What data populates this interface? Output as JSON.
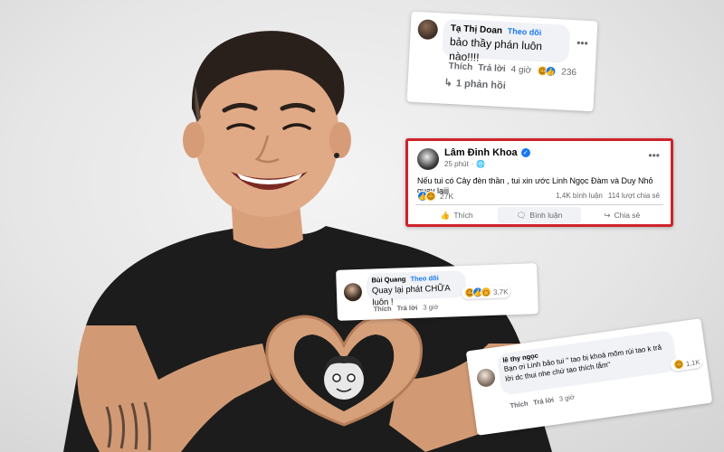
{
  "comment1": {
    "name": "Tạ Thị Doan",
    "follow": "Theo dõi",
    "text": "bảo thầy phán luôn nào!!!!",
    "like": "Thích",
    "reply": "Trả lời",
    "time": "4 giờ",
    "reaction_count": "236",
    "replies": "1 phản hồi"
  },
  "post": {
    "author": "Lâm Đinh Khoa",
    "time": "25 phút",
    "body": "Nếu tui có Cây đèn thần , tui xin ước Linh Ngọc Đàm và Duy Nhỏ quay lạiii",
    "reaction_count": "27K",
    "comments": "1,4K bình luận",
    "shares": "114 lượt chia sẻ",
    "like_button": "Thích",
    "comment_button": "Bình luận",
    "share_button": "Chia sẻ"
  },
  "comment3": {
    "name": "Bùi Quang",
    "follow": "Theo dõi",
    "text": "Quay lại phát CHỮA luôn !",
    "reaction_count": "3,7K",
    "like": "Thích",
    "reply": "Trả lời",
    "time": "3 giờ"
  },
  "comment4": {
    "name": "lê thy ngọc",
    "text": "Bạn ơi Linh bảo tui \" tao bị khoá mõm rùi tao k trả lời dc thui nhe chứ tao thích lắm\"",
    "reaction_count": "1,1K",
    "like": "Thích",
    "reply": "Trả lời",
    "time": "3 giờ"
  },
  "colors": {
    "highlight_border": "#d0222b",
    "facebook_blue": "#1877f2",
    "shirt": "#1b1b1b"
  },
  "icons": [
    "more-options-icon",
    "verified-badge-icon",
    "globe-icon",
    "like-icon",
    "comment-icon",
    "share-icon",
    "reply-arrow-icon"
  ]
}
